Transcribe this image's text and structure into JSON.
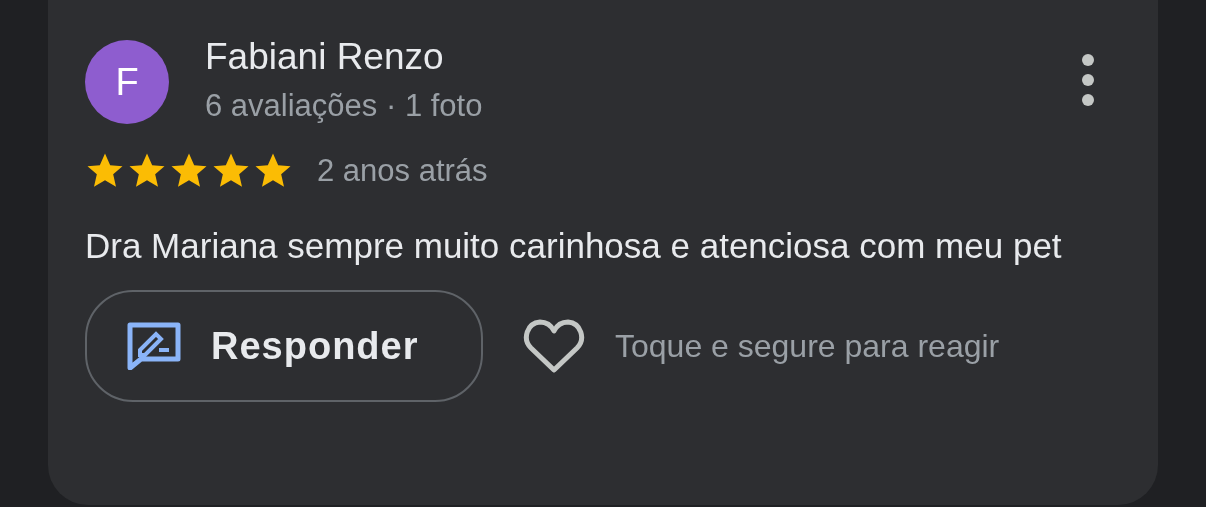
{
  "review": {
    "avatar_letter": "F",
    "author": "Fabiani Renzo",
    "author_meta": "6 avaliações · 1 foto",
    "stars": 5,
    "time": "2 anos atrás",
    "text": "Dra Mariana sempre muito carinhosa e atenciosa com meu pet"
  },
  "actions": {
    "reply_label": "Responder",
    "react_hint": "Toque e segure para reagir"
  }
}
